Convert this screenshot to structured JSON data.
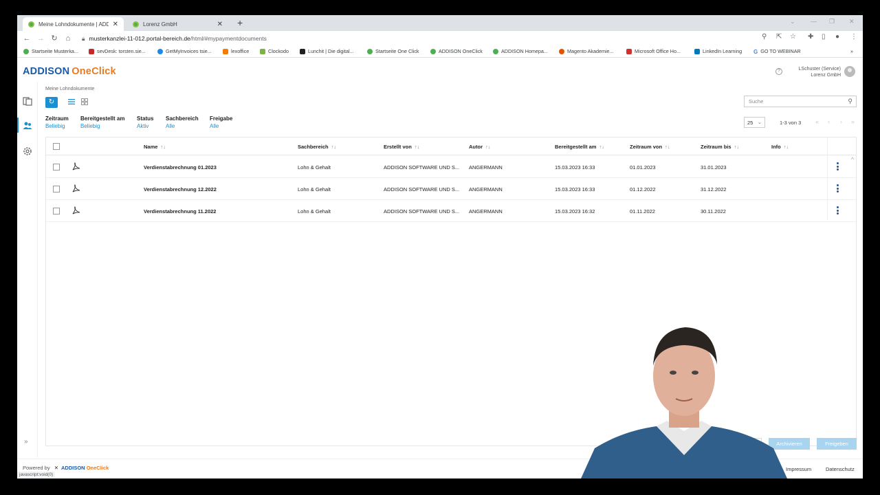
{
  "browser": {
    "tabs": [
      {
        "title": "Meine Lohndokumente | ADDISON",
        "active": true
      },
      {
        "title": "Lorenz GmbH",
        "active": false
      }
    ],
    "url_host": "musterkanzlei-11-012.portal-bereich.de",
    "url_path": "/html/#mypaymentdocuments",
    "bookmarks": [
      {
        "label": "Startseite Musterka...",
        "color": "#4caf50"
      },
      {
        "label": "sevDesk: torsten.sie...",
        "color": "#c62828"
      },
      {
        "label": "GetMyInvoices tsie...",
        "color": "#1e88e5"
      },
      {
        "label": "lexoffice",
        "color": "#f57c00"
      },
      {
        "label": "Clockodo",
        "color": "#7cb342"
      },
      {
        "label": "Lunchit | Die digital...",
        "color": "#212121"
      },
      {
        "label": "Startseite One Click",
        "color": "#4caf50"
      },
      {
        "label": "ADDISON OneClick",
        "color": "#4caf50"
      },
      {
        "label": "ADDISON Homepa...",
        "color": "#4caf50"
      },
      {
        "label": "Magento Akademie...",
        "color": "#e65100"
      },
      {
        "label": "Microsoft Office Ho...",
        "color": "#d32f2f"
      },
      {
        "label": "LinkedIn Learning",
        "color": "#0277bd"
      },
      {
        "label": "GO TO WEBINAR",
        "color": "#ffffff"
      }
    ]
  },
  "app": {
    "logo_a": "ADDISON",
    "logo_b": "OneClick",
    "user_name": "LSchuster (Service)",
    "user_company": "Lorenz GmbH"
  },
  "main": {
    "breadcrumb": "Meine Lohndokumente",
    "search_placeholder": "Suche",
    "page_size": "25",
    "page_count": "1-3 von 3",
    "filters": [
      {
        "label": "Zeitraum",
        "value": "Beliebig"
      },
      {
        "label": "Bereitgestellt am",
        "value": "Beliebig"
      },
      {
        "label": "Status",
        "value": "Aktiv"
      },
      {
        "label": "Sachbereich",
        "value": "Alle"
      },
      {
        "label": "Freigabe",
        "value": "Alle"
      }
    ]
  },
  "table": {
    "columns": [
      "Name",
      "Sachbereich",
      "Erstellt von",
      "Autor",
      "Bereitgestellt am",
      "Zeitraum von",
      "Zeitraum bis",
      "Info"
    ],
    "sort_symbol": "↑↓",
    "rows": [
      [
        "Verdienstabrechnung 01.2023",
        "Lohn & Gehalt",
        "ADDISON SOFTWARE UND S...",
        "ANGERMANN",
        "15.03.2023 16:33",
        "01.01.2023",
        "31.01.2023",
        ""
      ],
      [
        "Verdienstabrechnung 12.2022",
        "Lohn & Gehalt",
        "ADDISON SOFTWARE UND S...",
        "ANGERMANN",
        "15.03.2023 16:33",
        "01.12.2022",
        "31.12.2022",
        ""
      ],
      [
        "Verdienstabrechnung 11.2022",
        "Lohn & Gehalt",
        "ADDISON SOFTWARE UND S...",
        "ANGERMANN",
        "15.03.2023 16:32",
        "01.11.2022",
        "30.11.2022",
        ""
      ]
    ]
  },
  "actions": {
    "archive": "Archivieren",
    "release": "Freigeben"
  },
  "footer": {
    "powered_by": "Powered by",
    "brand_a": "ADDISON",
    "brand_b": "OneClick",
    "status_url": "javascript:void(0)",
    "impressum": "Impressum",
    "datenschutz": "Datenschutz"
  }
}
